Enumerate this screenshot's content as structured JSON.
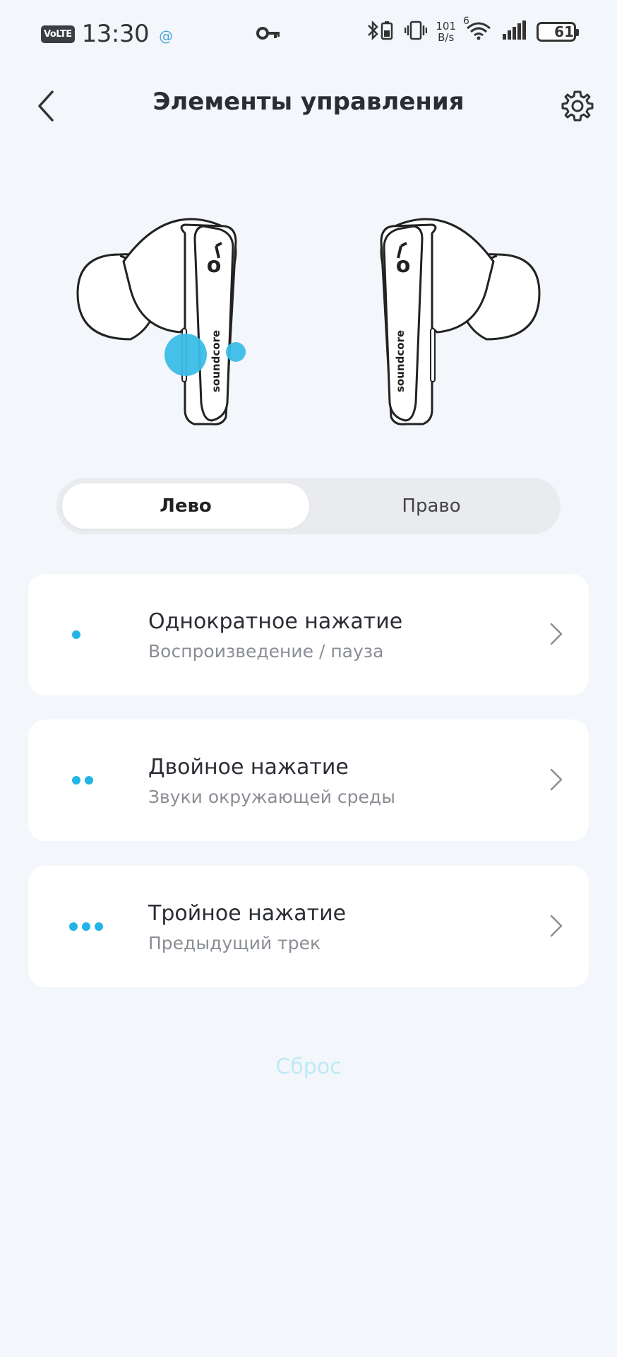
{
  "status_bar": {
    "volte": "VoLTE",
    "time": "13:30",
    "at_symbol": "@",
    "net_speed_value": "101",
    "net_speed_unit": "B/s",
    "network": "6",
    "battery_level": "61",
    "battery_fraction": 0.61,
    "icons": [
      "key-icon",
      "bluetooth-battery-icon",
      "vibrate-icon",
      "wifi-icon",
      "signal-icon",
      "battery-icon"
    ]
  },
  "header": {
    "title": "Элементы управления",
    "back_icon": "chevron-left-icon",
    "settings_icon": "gear-icon"
  },
  "earbuds": {
    "brand": "soundcore",
    "highlight_color": "#3bbde8"
  },
  "segment": {
    "left_label": "Лево",
    "right_label": "Право",
    "selected": "Лево"
  },
  "controls": [
    {
      "title": "Однократное нажатие",
      "action": "Воспроизведение / пауза",
      "taps": 1
    },
    {
      "title": "Двойное нажатие",
      "action": "Звуки окружающей среды",
      "taps": 2
    },
    {
      "title": "Тройное нажатие",
      "action": "Предыдущий трек",
      "taps": 3
    }
  ],
  "reset_label": "Сброс",
  "colors": {
    "background": "#f3f6fa",
    "accent": "#22b4e6",
    "reset_text": "#bfe9f7"
  }
}
